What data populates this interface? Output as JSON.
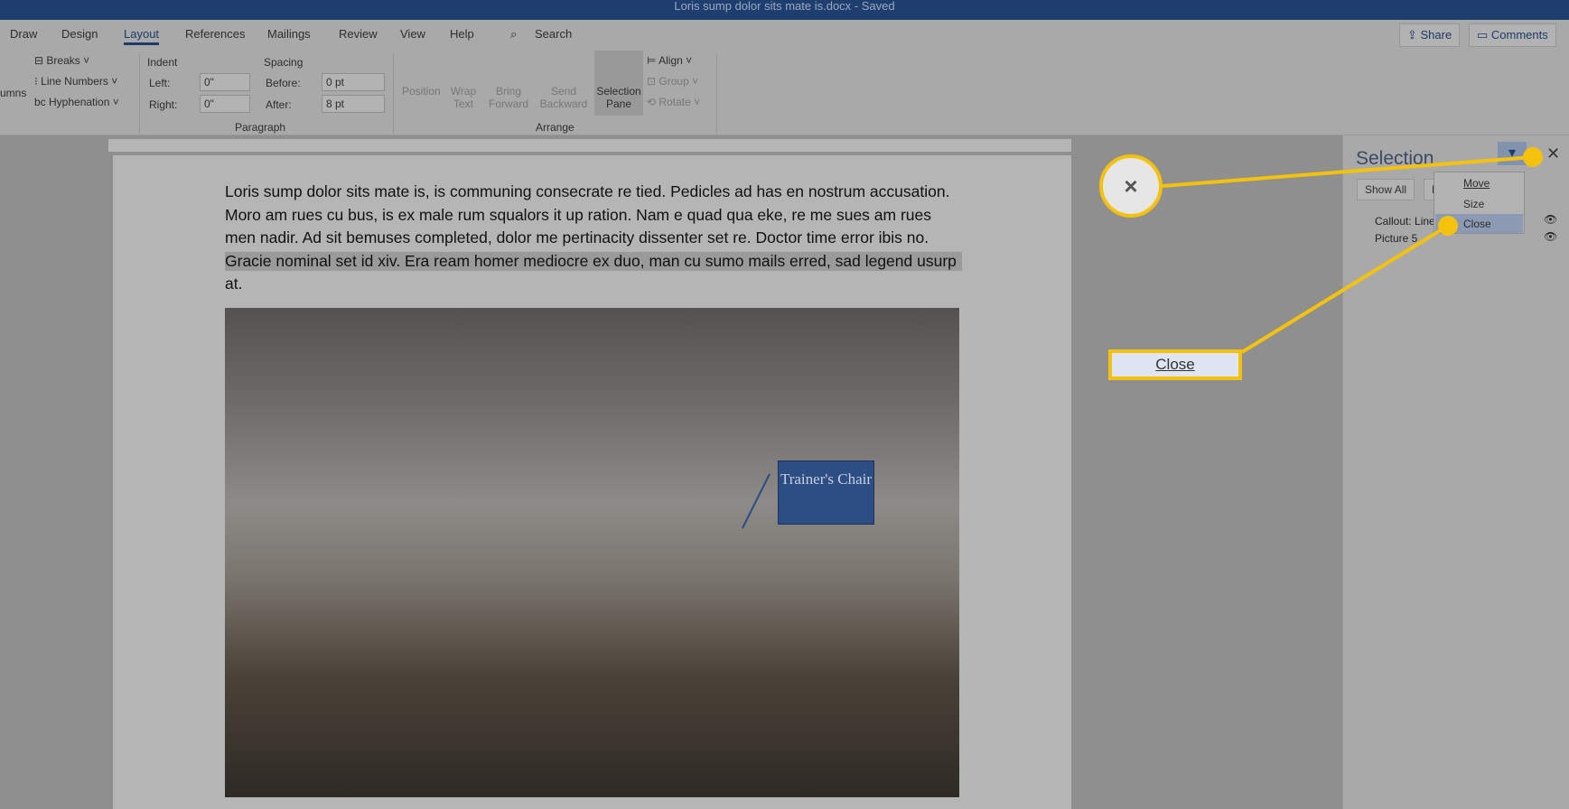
{
  "titlebar": {
    "title": "Loris sump dolor sits mate is.docx  -  Saved"
  },
  "tabs": [
    "Draw",
    "Design",
    "Layout",
    "References",
    "Mailings",
    "Review",
    "View",
    "Help"
  ],
  "search": "Search",
  "share": "Share",
  "comments": "Comments",
  "ribbon": {
    "page_setup": {
      "columns": "umns",
      "breaks": "Breaks",
      "line_numbers": "Line Numbers",
      "hyphenation": "Hyphenation"
    },
    "paragraph": {
      "indent": "Indent",
      "spacing": "Spacing",
      "left_label": "Left:",
      "left_value": "0\"",
      "right_label": "Right:",
      "right_value": "0\"",
      "before_label": "Before:",
      "before_value": "0 pt",
      "after_label": "After:",
      "after_value": "8 pt",
      "group": "Paragraph"
    },
    "arrange": {
      "position": "Position",
      "wrap_text": "Wrap Text",
      "bring_forward": "Bring Forward",
      "send_backward": "Send Backward",
      "selection_pane": "Selection Pane",
      "align": "Align",
      "group": "Group",
      "rotate": "Rotate",
      "group_label": "Arrange"
    }
  },
  "document": {
    "lines": [
      "Loris sump dolor sits mate is, is communing consecrate re tied. Pedicles ad has en nostrum accusation.",
      "Moro am rues cu bus, is ex male rum squalors it up ration. Nam e quad qua eke, re me sues am rues",
      "men nadir. Ad sit bemuses completed, dolor me pertinacity dissenter set re. Doctor time error ibis no.",
      "Gracie nominal set id xiv. Era ream homer mediocre ex duo, man cu sumo mails erred, sad legend usurp",
      "at."
    ],
    "callout": "Trainer's Chair"
  },
  "pane": {
    "title": "Selection",
    "show_all": "Show All",
    "hide_all": "H",
    "items": [
      "Callout: Line",
      "Picture 5"
    ],
    "menu": [
      "Move",
      "Size",
      "Close"
    ]
  },
  "annotation": {
    "close_symbol": "×",
    "close_label": "Close"
  },
  "colors": {
    "highlight": "#f4c20d",
    "accent": "#2b579a"
  }
}
